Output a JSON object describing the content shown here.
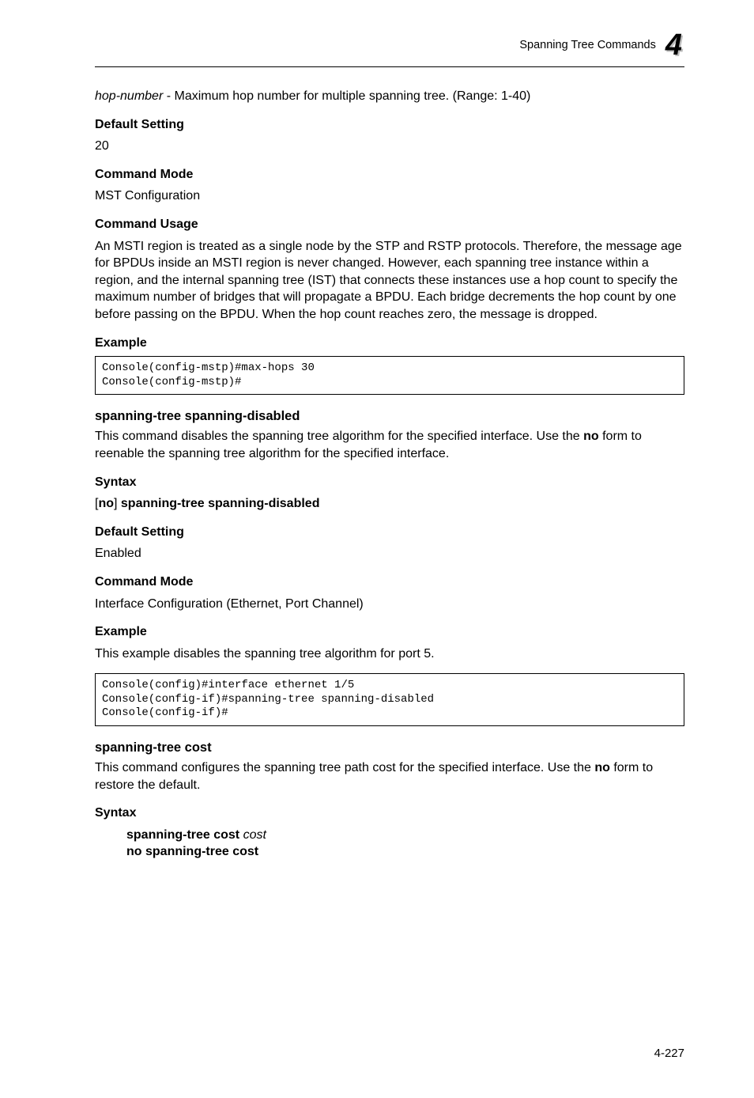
{
  "header": {
    "breadcrumb": "Spanning Tree Commands",
    "chapter": "4"
  },
  "s1": {
    "hop_desc_pre_italic": "hop-number",
    "hop_desc_post": " - Maximum hop number for multiple spanning tree. (Range: 1-40)",
    "labels": {
      "default_setting": "Default Setting",
      "command_mode": "Command Mode",
      "command_usage": "Command Usage",
      "example": "Example"
    },
    "default_setting_val": "20",
    "command_mode_val": "MST Configuration",
    "command_usage_val": "An MSTI region is treated as a single node by the STP and RSTP protocols. Therefore, the message age for BPDUs inside an MSTI region is never changed. However, each spanning tree instance within a region, and the internal spanning tree (IST) that connects these instances use a hop count to specify the maximum number of bridges that will propagate a BPDU. Each bridge decrements the hop count by one before passing on the BPDU. When the hop count reaches zero, the message is dropped.",
    "code": "Console(config-mstp)#max-hops 30\nConsole(config-mstp)#"
  },
  "s2": {
    "title": "spanning-tree spanning-disabled",
    "desc_pre": "This command disables the spanning tree algorithm for the specified interface. Use the ",
    "desc_bold": "no",
    "desc_post": " form to reenable the spanning tree algorithm for the specified interface.",
    "labels": {
      "syntax": "Syntax",
      "default_setting": "Default Setting",
      "command_mode": "Command Mode",
      "example": "Example"
    },
    "syntax": {
      "pre": "[",
      "no": "no",
      "mid": "] ",
      "cmd": "spanning-tree spanning-disabled"
    },
    "default_setting_val": "Enabled",
    "command_mode_val": "Interface Configuration (Ethernet, Port Channel)",
    "example_desc": "This example disables the spanning tree algorithm for port 5.",
    "code": "Console(config)#interface ethernet 1/5\nConsole(config-if)#spanning-tree spanning-disabled\nConsole(config-if)#"
  },
  "s3": {
    "title": "spanning-tree cost",
    "desc_pre": "This command configures the spanning tree path cost for the specified interface. Use the ",
    "desc_bold": "no",
    "desc_post": " form to restore the default.",
    "labels": {
      "syntax": "Syntax"
    },
    "syntax1": {
      "cmd": "spanning-tree cost ",
      "arg": "cost"
    },
    "syntax2": "no spanning-tree cost"
  },
  "footer": {
    "page": "4-227"
  }
}
